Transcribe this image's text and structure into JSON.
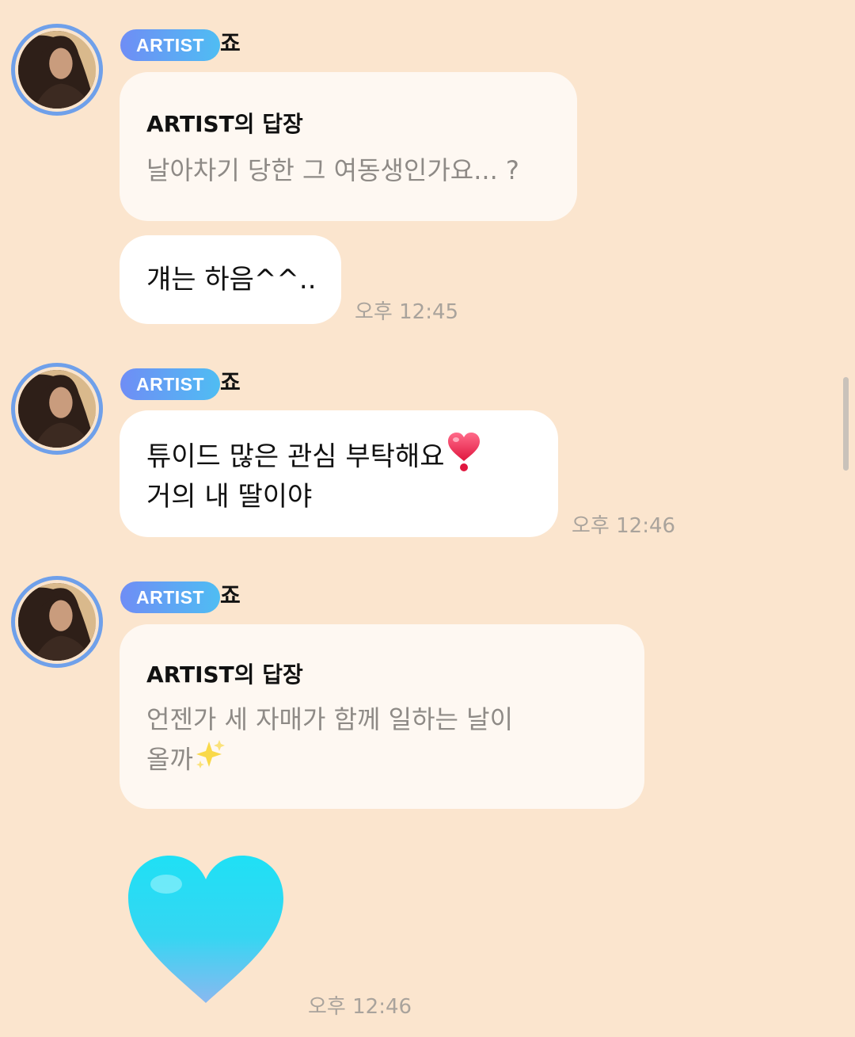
{
  "messages": [
    {
      "badge": "ARTIST",
      "sender": "죠",
      "reply_title": "ARTIST의 답장",
      "reply_text": "날아차기 당한 그 여동생인가요... ?",
      "message": "걔는 하음^^..",
      "time": "오후 12:45"
    },
    {
      "badge": "ARTIST",
      "sender": "죠",
      "message_line1": " 튜이드 많은 관심 부탁해요",
      "message_line2": "거의 내 딸이야",
      "emoji": "heart-exclamation-icon",
      "time": "오후 12:46"
    },
    {
      "badge": "ARTIST",
      "sender": "죠",
      "reply_title": "ARTIST의 답장",
      "reply_line1": "언젠가 세 자매가 함께 일하는 날이",
      "reply_line2": "올까",
      "emoji": "sparkles-icon",
      "sticker": "light-blue-heart-icon",
      "time": "오후 12:46"
    }
  ],
  "colors": {
    "background": "#FBE5CE",
    "badge_start": "#6F8DF5",
    "badge_end": "#4FBDF3",
    "avatar_ring": "#6FA0EA",
    "heart": "#35D6F2"
  }
}
